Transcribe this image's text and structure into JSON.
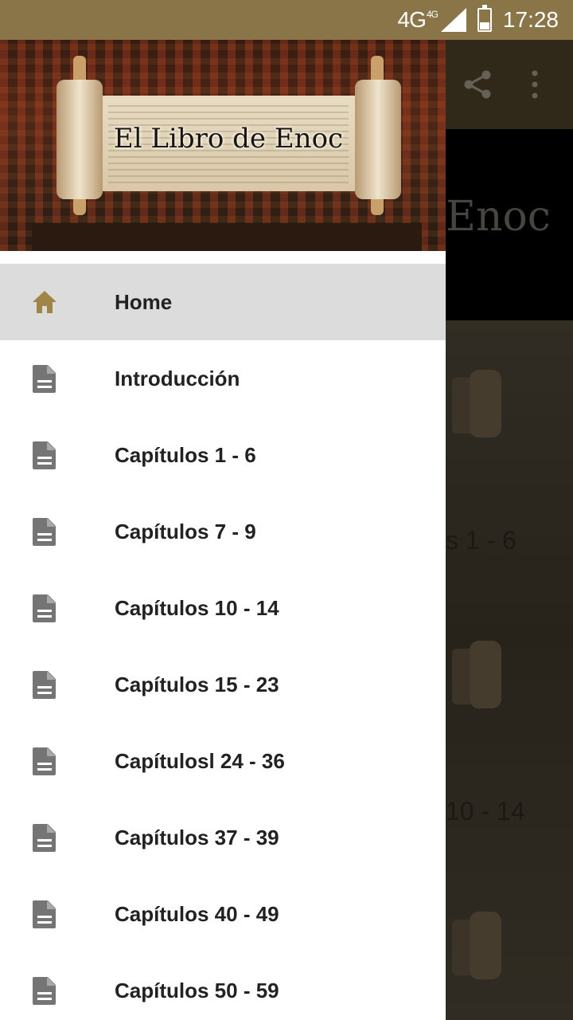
{
  "status_bar": {
    "network": "4G",
    "network_small": "4G",
    "time": "17:28"
  },
  "background_app": {
    "banner_text": "Enoc",
    "cards": [
      {
        "label": "s 1 - 6"
      },
      {
        "label": "10 - 14"
      }
    ],
    "toolbar_icons": [
      "share-icon",
      "more-vert-icon"
    ]
  },
  "drawer": {
    "header_title": "El Libro de Enoc",
    "items": [
      {
        "label": "Home",
        "icon": "home-icon",
        "active": true
      },
      {
        "label": "Introducción",
        "icon": "document-icon"
      },
      {
        "label": "Capítulos 1 - 6",
        "icon": "document-icon"
      },
      {
        "label": "Capítulos 7 - 9",
        "icon": "document-icon"
      },
      {
        "label": "Capítulos 10 - 14",
        "icon": "document-icon"
      },
      {
        "label": "Capítulos 15 - 23",
        "icon": "document-icon"
      },
      {
        "label": "Capítulosl 24 - 36",
        "icon": "document-icon"
      },
      {
        "label": "Capítulos 37 - 39",
        "icon": "document-icon"
      },
      {
        "label": "Capítulos 40 - 49",
        "icon": "document-icon"
      },
      {
        "label": "Capítulos 50 - 59",
        "icon": "document-icon"
      }
    ]
  },
  "colors": {
    "status_bar": "#8a7549",
    "accent_icon": "#a08448",
    "active_item": "#dcdcdc",
    "doc_icon": "#757575"
  }
}
